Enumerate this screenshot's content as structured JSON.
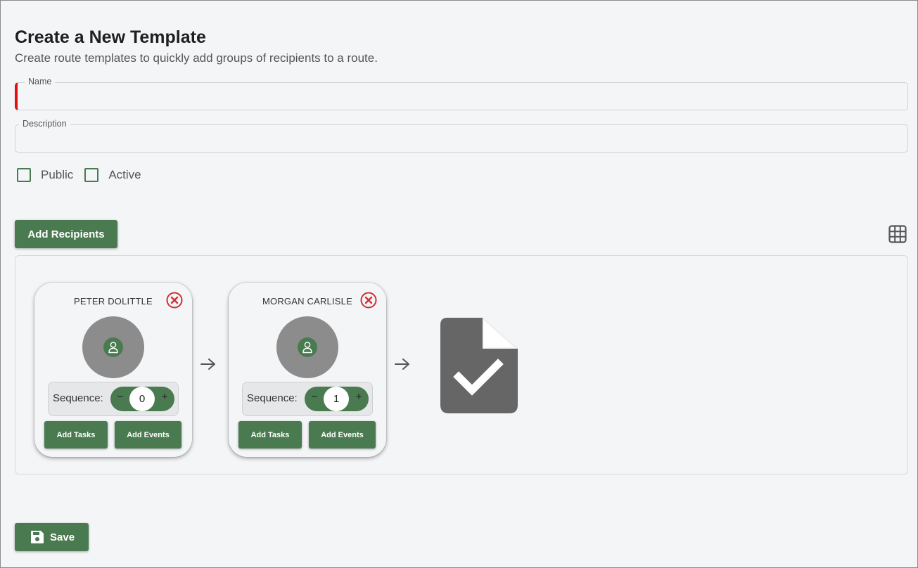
{
  "header": {
    "title": "Create a New Template",
    "subtitle": "Create route templates to quickly add groups of recipients to a route."
  },
  "form": {
    "name_label": "Name",
    "name_value": "",
    "description_label": "Description",
    "description_value": "",
    "public_label": "Public",
    "public_checked": false,
    "active_label": "Active",
    "active_checked": false
  },
  "toolbar": {
    "add_recipients_label": "Add Recipients",
    "grid_icon": "grid-view-icon"
  },
  "recipients": [
    {
      "name": "PETER DOLITTLE",
      "sequence_label": "Sequence:",
      "sequence": "0",
      "add_tasks": "Add Tasks",
      "add_events": "Add Events"
    },
    {
      "name": "MORGAN CARLISLE",
      "sequence_label": "Sequence:",
      "sequence": "1",
      "add_tasks": "Add Tasks",
      "add_events": "Add Events"
    }
  ],
  "stepper": {
    "minus": "−",
    "plus": "+"
  },
  "final_icon": "document-check-icon",
  "footer": {
    "save_label": "Save"
  },
  "colors": {
    "primary": "#4a7a50",
    "danger": "#d32f2f",
    "required": "#e01010",
    "avatar": "#8c8c8c",
    "doc_icon": "#666666"
  }
}
